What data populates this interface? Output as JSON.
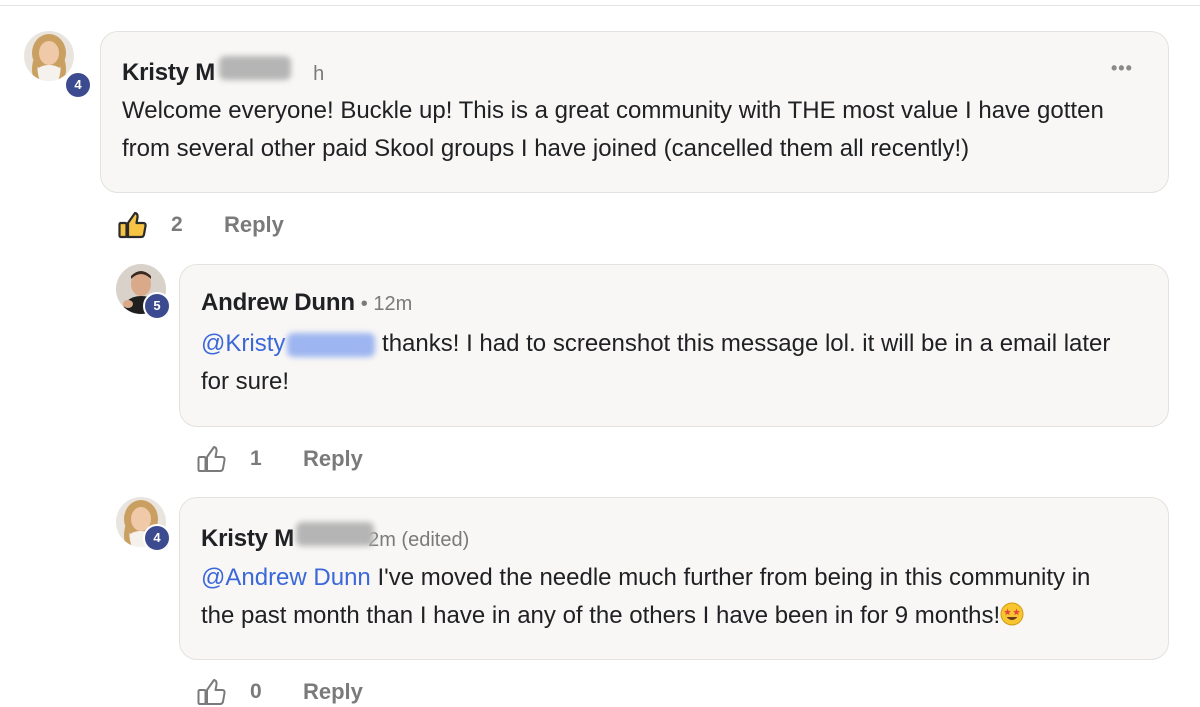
{
  "comments": [
    {
      "author": "Kristy M",
      "time": "h",
      "level": "4",
      "more": "•••",
      "lines": [
        "Welcome everyone! Buckle up! This is a great community with THE most value I have gotten",
        "from several other paid Skool groups I have joined (cancelled them all recently!)"
      ],
      "likes": "2",
      "reply_label": "Reply",
      "liked": true
    },
    {
      "author": "Andrew Dunn",
      "time": "• 12m",
      "level": "5",
      "mention": "@Kristy",
      "line1_rest": " thanks! I had to screenshot this message lol. it will be in a email later",
      "line2": "for sure!",
      "likes": "1",
      "reply_label": "Reply"
    },
    {
      "author": "Kristy M",
      "time": "2m (edited)",
      "level": "4",
      "mention": "@Andrew Dunn",
      "line1_rest": " I've moved the needle much further from being in this community in",
      "line2": "the past month than I have in any of the others I have been in for 9 months!",
      "likes": "0",
      "reply_label": "Reply"
    }
  ],
  "colors": {
    "bubble_bg": "#f8f7f5",
    "mention": "#3b68d9",
    "level_badge": "#3c4a8f",
    "muted": "#7a7a7a"
  },
  "icons": [
    "thumbs-up-icon",
    "more-options-icon",
    "star-struck-emoji-icon"
  ]
}
